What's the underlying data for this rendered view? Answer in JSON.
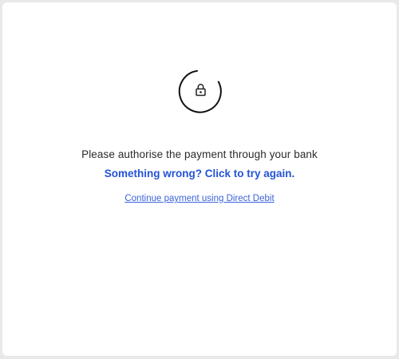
{
  "status": {
    "message": "Please authorise the payment through your bank",
    "retry_link": "Something wrong? Click to try again.",
    "alternative_link": "Continue payment using Direct Debit"
  },
  "icons": {
    "spinner": "loading-spinner-icon",
    "lock": "lock-icon"
  },
  "colors": {
    "link": "#2453d6",
    "text": "#2b2b2b",
    "spinner": "#111111"
  }
}
